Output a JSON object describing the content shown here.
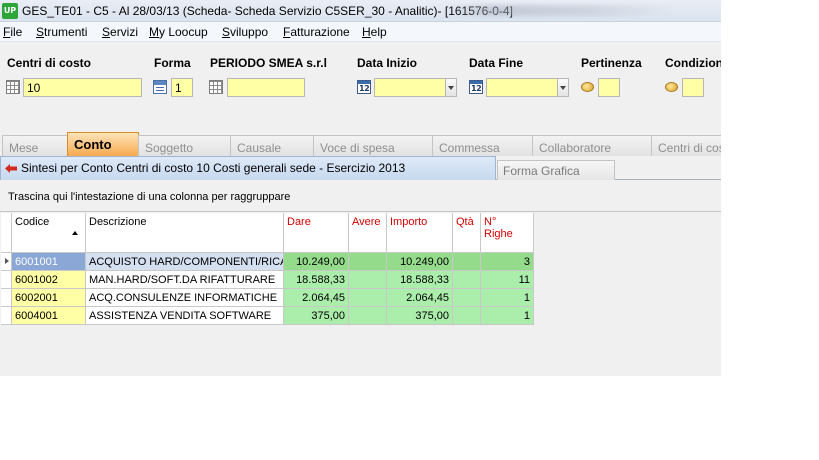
{
  "window": {
    "app_icon_text": "UP",
    "title": "GES_TE01 - C5 - Al 28/03/13 (Scheda- Scheda Servizio C5SER_30 - Analitic)- [161576-0-4]"
  },
  "menu": [
    "File",
    "Strumenti",
    "Servizi",
    "My Loocup",
    "Sviluppo",
    "Fatturazione",
    "Help"
  ],
  "filters": {
    "centri_label": "Centri di costo",
    "centri_value": "10",
    "forma_label": "Forma",
    "forma_value": "1",
    "periodo_label": "PERIODO SMEA s.r.l",
    "periodo_value": "",
    "data_inizio_label": "Data Inizio",
    "data_inizio_value": "",
    "data_fine_label": "Data Fine",
    "data_fine_value": "",
    "pertinenza_label": "Pertinenza",
    "pertinenza_value": "",
    "condizioni_label": "Condizioni",
    "condizioni_value": "",
    "calendar_icon_text": "12"
  },
  "tabs": [
    "Mese",
    "Conto",
    "Soggetto",
    "Causale",
    "Voce di spesa",
    "Commessa",
    "Collaboratore",
    "Centri di costo"
  ],
  "active_tab": "Conto",
  "subtabs": {
    "active": "Sintesi per Conto Centri di costo 10 Costi generali sede - Esercizio 2013",
    "other": "Forma Grafica"
  },
  "group_hint": "Trascina qui l'intestazione di una colonna per raggruppare",
  "grid": {
    "headers": {
      "codice": "Codice",
      "descrizione": "Descrizione",
      "dare": "Dare",
      "avere": "Avere",
      "importo": "Importo",
      "qta": "Qtà",
      "righe_1": "N°",
      "righe_2": "Righe"
    },
    "rows": [
      {
        "codice": "6001001",
        "descrizione": "ACQUISTO HARD/COMPONENTI/RICAMBI",
        "dare": "10.249,00",
        "avere": "",
        "importo": "10.249,00",
        "qta": "",
        "righe": "3"
      },
      {
        "codice": "6001002",
        "descrizione": "MAN.HARD/SOFT.DA RIFATTURARE",
        "dare": "18.588,33",
        "avere": "",
        "importo": "18.588,33",
        "qta": "",
        "righe": "11"
      },
      {
        "codice": "6002001",
        "descrizione": "ACQ.CONSULENZE INFORMATICHE",
        "dare": "2.064,45",
        "avere": "",
        "importo": "2.064,45",
        "qta": "",
        "righe": "1"
      },
      {
        "codice": "6004001",
        "descrizione": "ASSISTENZA VENDITA SOFTWARE",
        "dare": "375,00",
        "avere": "",
        "importo": "375,00",
        "qta": "",
        "righe": "1"
      }
    ]
  },
  "colors": {
    "field_yellow": "#ffffa5",
    "number_green": "#abedab",
    "header_red": "#d40000",
    "active_tab_orange": "#f6a94f",
    "selected_code_blue": "#8aa7d6"
  }
}
